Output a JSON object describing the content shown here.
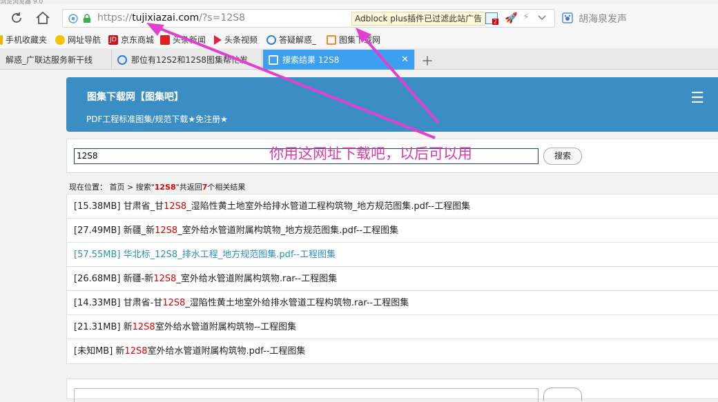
{
  "browser": {
    "top_strip": "浏览浏览器 9.0",
    "address": {
      "scheme": "https://",
      "domain": "tujixiazai.com",
      "path": "/?s=12S8",
      "adblock_notice": "Adblock plus插件已过滤此站广告",
      "adblock_count": "2"
    },
    "side_search": "胡海泉发声",
    "bookmarks": [
      {
        "label": "手机收藏夹",
        "icon": "folder-icon",
        "color": "#f0b400"
      },
      {
        "label": "网址导航",
        "icon": "nav-icon",
        "color": "#f4c400"
      },
      {
        "label": "京东商城",
        "icon": "jd-icon",
        "color": "#c9151e"
      },
      {
        "label": "头条新闻",
        "icon": "news-icon",
        "color": "#e02020"
      },
      {
        "label": "头条视频",
        "icon": "video-icon",
        "color": "#e0204a"
      },
      {
        "label": "答疑解惑_",
        "icon": "qa-icon",
        "color": "#2a7ed8"
      },
      {
        "label": "图集下载网",
        "icon": "site-icon",
        "color": "#f08a24"
      }
    ],
    "tabs": [
      {
        "label": "解惑_广联达服务新干线"
      },
      {
        "label": "那位有12S2和12S8图集帮忙发"
      },
      {
        "label": "搜索结果 12S8",
        "active": true
      }
    ]
  },
  "site": {
    "title": "图集下载网【图集吧】",
    "subtitle": "PDF工程标准图集/规范下载★免注册★",
    "search_value": "12S8",
    "search_button": "搜索",
    "annotation": "你用这网址下载吧，以后可以用",
    "breadcrumb": {
      "prefix": "现在位置： 首页 > 搜索\"",
      "keyword": "12S8",
      "middle": "\"共返回",
      "count": "7",
      "suffix": "个相关结果"
    },
    "results": [
      {
        "pre": "[15.38MB] 甘肃省_甘",
        "kw": "12S8",
        "post": "_湿陷性黄土地室外给排水管道工程构筑物_地方规范图集.pdf--工程图集"
      },
      {
        "pre": "[27.49MB] 新疆_新",
        "kw": "12S8",
        "post": "_室外给水管道附属构筑物_地方规范图集.pdf--工程图集"
      },
      {
        "pre": "[57.55MB] 华北标_",
        "kw": "12S8",
        "post": "_排水工程_地方规范图集.pdf--工程图集",
        "highlight": true
      },
      {
        "pre": "[26.68MB] 新疆-新",
        "kw": "12S8",
        "post": "_室外给水管道附属构筑物.rar--工程图集"
      },
      {
        "pre": "[14.33MB] 甘肃省-甘",
        "kw": "12S8",
        "post": "_湿陷性黄土地室外给排水管道工程构筑物.rar--工程图集"
      },
      {
        "pre": "[21.31MB] 新",
        "kw": "12S8",
        "post": "室外给水管道附属构筑物--工程图集"
      },
      {
        "pre": "[未知MB] 新",
        "kw": "12S8",
        "post": "室外给水管道附属构筑物.pdf--工程图集"
      }
    ]
  },
  "colors": {
    "header_blue": "#3b8ec4",
    "tab_active": "#3c9ff0",
    "keyword_red": "#dd0000",
    "annotation_pink": "#d83aa8"
  }
}
